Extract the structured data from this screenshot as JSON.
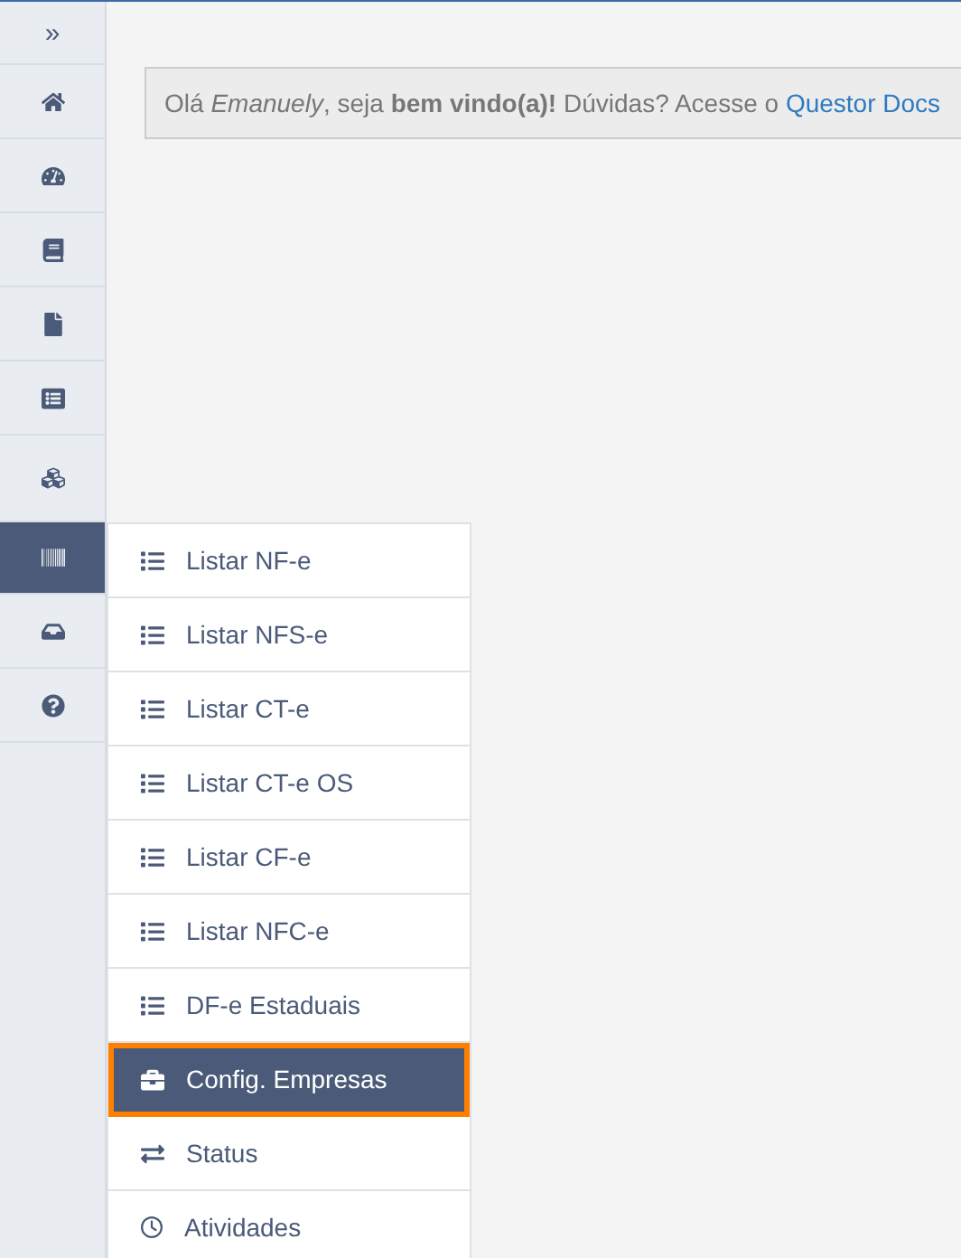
{
  "sidebar": {
    "toggle": "»",
    "items": [
      {
        "selected": false
      },
      {
        "selected": false
      },
      {
        "selected": false
      },
      {
        "selected": false
      },
      {
        "selected": false
      },
      {
        "selected": false
      },
      {
        "selected": true
      },
      {
        "selected": false
      },
      {
        "selected": false
      }
    ]
  },
  "banner": {
    "text": "Olá *Emanuely*, seja **bem vindo(a)!** Dúvidas? Acesse o",
    "link": "Questor Docs"
  },
  "submenu": {
    "items": [
      {
        "label": "Listar NF-e",
        "selected": false
      },
      {
        "label": "Listar NFS-e",
        "selected": false
      },
      {
        "label": "Listar CT-e",
        "selected": false
      },
      {
        "label": "Listar CT-e OS",
        "selected": false
      },
      {
        "label": "Listar CF-e",
        "selected": false
      },
      {
        "label": "Listar NFC-e",
        "selected": false
      },
      {
        "label": "DF-e Estaduais",
        "selected": false
      },
      {
        "label": "Config. Empresas",
        "selected": true
      },
      {
        "label": "Status",
        "selected": false
      },
      {
        "label": "Atividades",
        "selected": false
      }
    ]
  }
}
